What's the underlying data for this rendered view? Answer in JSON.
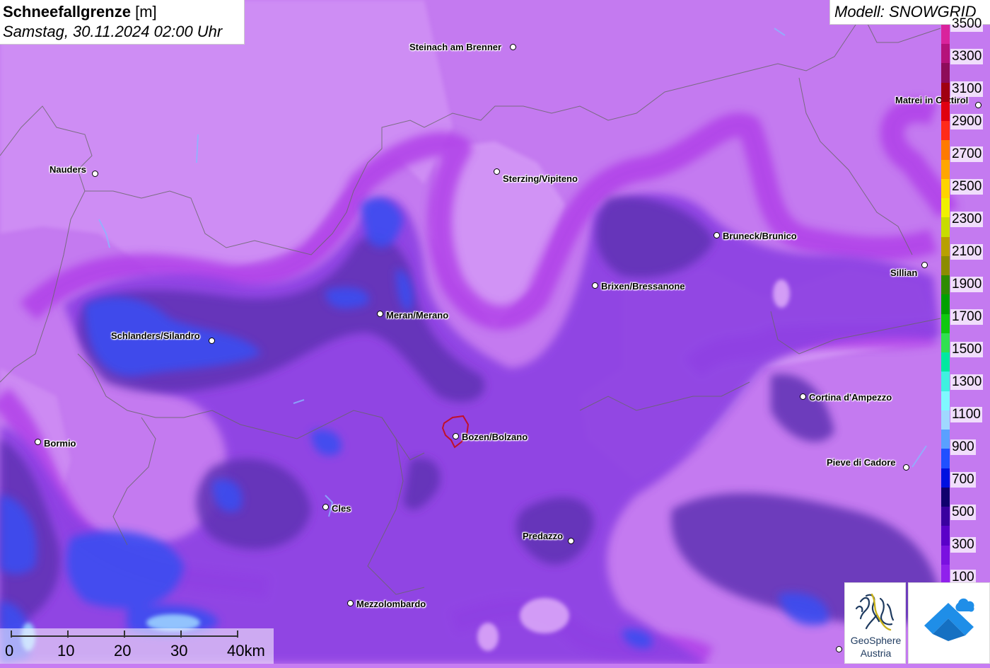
{
  "title": {
    "main": "Schneefallgrenze",
    "unit": "[m]",
    "datetime": "Samstag, 30.11.2024 02:00 Uhr"
  },
  "model": "Modell: SNOWGRID",
  "legend": {
    "labels": [
      "3500",
      "3300",
      "3100",
      "2900",
      "2700",
      "2500",
      "2300",
      "2100",
      "1900",
      "1700",
      "1500",
      "1300",
      "1100",
      "900",
      "700",
      "500",
      "300",
      "100"
    ],
    "colors": [
      "#d9239c",
      "#b5127a",
      "#8e0c5a",
      "#a00010",
      "#e00010",
      "#ff2a1a",
      "#ff7a00",
      "#ffa600",
      "#ffd400",
      "#f0f000",
      "#c8dc00",
      "#b8a000",
      "#8c8c00",
      "#2e8b00",
      "#00a000",
      "#10c810",
      "#30e050",
      "#00e8a0",
      "#40f0e0",
      "#80f8ff",
      "#a0d8ff",
      "#5aa0ff",
      "#2050ff",
      "#0010e0",
      "#10006e",
      "#3a00a0",
      "#5a00c8",
      "#7a10e0",
      "#9020ec"
    ]
  },
  "cities": [
    {
      "name": "Steinach am Brenner"
    },
    {
      "name": "Matrei in Osttirol"
    },
    {
      "name": "Nauders"
    },
    {
      "name": "Sterzing/Vipiteno"
    },
    {
      "name": "Bruneck/Brunico"
    },
    {
      "name": "Sillian"
    },
    {
      "name": "Brixen/Bressanone"
    },
    {
      "name": "Meran/Merano"
    },
    {
      "name": "Schlanders/Silandro"
    },
    {
      "name": "Cortina d'Ampezzo"
    },
    {
      "name": "Bozen/Bolzano"
    },
    {
      "name": "Bormio"
    },
    {
      "name": "Pieve di Cadore"
    },
    {
      "name": "Cles"
    },
    {
      "name": "Predazzo"
    },
    {
      "name": "Mezzolombardo"
    }
  ],
  "scale": {
    "labels": [
      "0",
      "10",
      "20",
      "30",
      "40km"
    ]
  },
  "logos": {
    "geosphere_line1": "GeoSphere",
    "geosphere_line2": "Austria"
  },
  "colors": {
    "lilac": "#c47af0",
    "magenta_band": "#b240e6",
    "purple": "#8a3ee0",
    "dark_purple": "#5c2fb0",
    "blue": "#3a4ef0",
    "light_area": "#d596f5"
  }
}
